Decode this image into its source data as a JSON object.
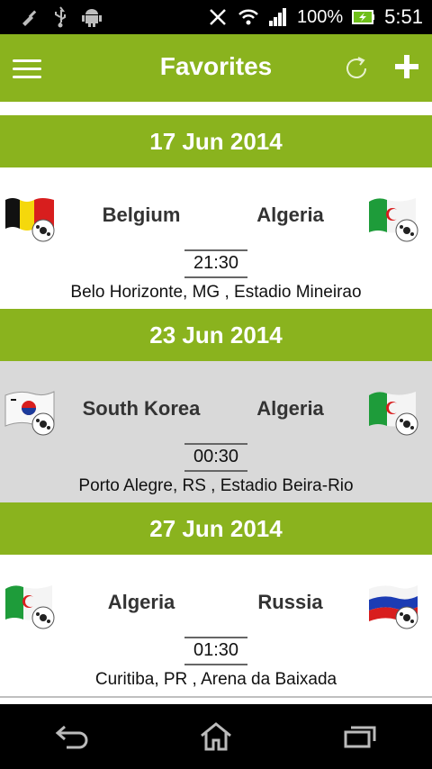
{
  "status_bar": {
    "battery": "100%",
    "time": "5:51"
  },
  "action_bar": {
    "title": "Favorites"
  },
  "dates": [
    "17 Jun 2014",
    "23 Jun 2014",
    "27 Jun 2014"
  ],
  "matches": [
    {
      "home": "Belgium",
      "away": "Algeria",
      "time": "21:30",
      "venue": "Belo Horizonte, MG , Estadio Mineirao",
      "home_flag": "belgium-flag-icon",
      "away_flag": "algeria-flag-icon"
    },
    {
      "home": "South Korea",
      "away": "Algeria",
      "time": "00:30",
      "venue": "Porto Alegre, RS , Estadio Beira-Rio",
      "home_flag": "south-korea-flag-icon",
      "away_flag": "algeria-flag-icon"
    },
    {
      "home": "Algeria",
      "away": "Russia",
      "time": "01:30",
      "venue": "Curitiba, PR , Arena da Baixada",
      "home_flag": "algeria-flag-icon",
      "away_flag": "russia-flag-icon"
    }
  ],
  "colors": {
    "accent": "#8ab31e",
    "selected_row": "#d9d9d9"
  }
}
